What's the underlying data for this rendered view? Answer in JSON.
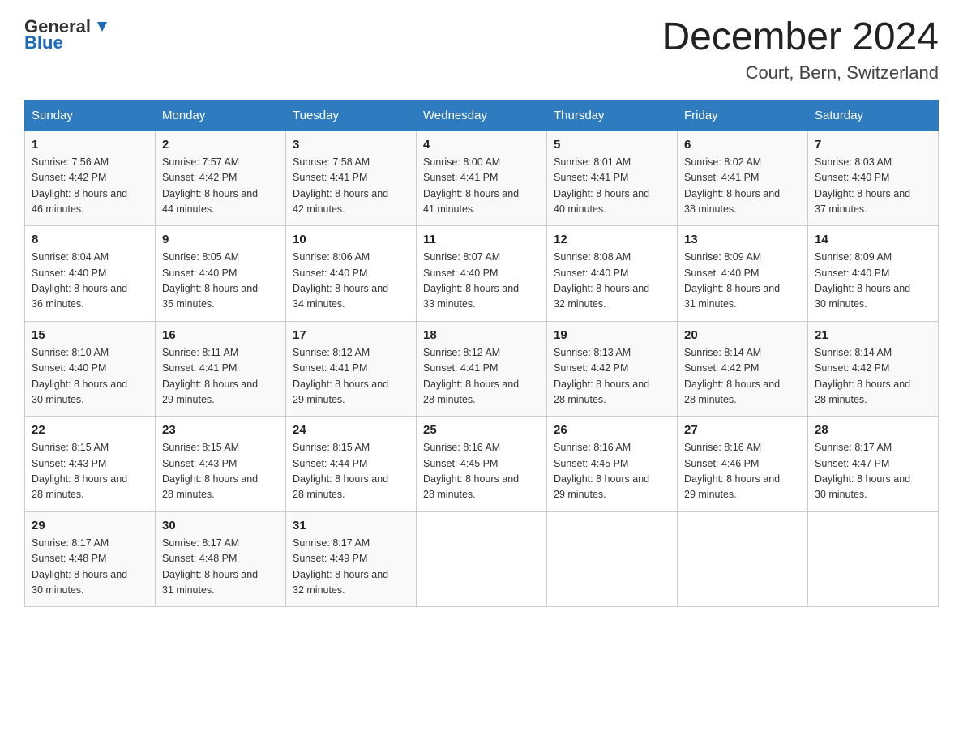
{
  "header": {
    "logo_general": "General",
    "logo_blue": "Blue",
    "month_title": "December 2024",
    "location": "Court, Bern, Switzerland"
  },
  "columns": [
    "Sunday",
    "Monday",
    "Tuesday",
    "Wednesday",
    "Thursday",
    "Friday",
    "Saturday"
  ],
  "weeks": [
    [
      {
        "day": "1",
        "sunrise": "7:56 AM",
        "sunset": "4:42 PM",
        "daylight": "8 hours and 46 minutes."
      },
      {
        "day": "2",
        "sunrise": "7:57 AM",
        "sunset": "4:42 PM",
        "daylight": "8 hours and 44 minutes."
      },
      {
        "day": "3",
        "sunrise": "7:58 AM",
        "sunset": "4:41 PM",
        "daylight": "8 hours and 42 minutes."
      },
      {
        "day": "4",
        "sunrise": "8:00 AM",
        "sunset": "4:41 PM",
        "daylight": "8 hours and 41 minutes."
      },
      {
        "day": "5",
        "sunrise": "8:01 AM",
        "sunset": "4:41 PM",
        "daylight": "8 hours and 40 minutes."
      },
      {
        "day": "6",
        "sunrise": "8:02 AM",
        "sunset": "4:41 PM",
        "daylight": "8 hours and 38 minutes."
      },
      {
        "day": "7",
        "sunrise": "8:03 AM",
        "sunset": "4:40 PM",
        "daylight": "8 hours and 37 minutes."
      }
    ],
    [
      {
        "day": "8",
        "sunrise": "8:04 AM",
        "sunset": "4:40 PM",
        "daylight": "8 hours and 36 minutes."
      },
      {
        "day": "9",
        "sunrise": "8:05 AM",
        "sunset": "4:40 PM",
        "daylight": "8 hours and 35 minutes."
      },
      {
        "day": "10",
        "sunrise": "8:06 AM",
        "sunset": "4:40 PM",
        "daylight": "8 hours and 34 minutes."
      },
      {
        "day": "11",
        "sunrise": "8:07 AM",
        "sunset": "4:40 PM",
        "daylight": "8 hours and 33 minutes."
      },
      {
        "day": "12",
        "sunrise": "8:08 AM",
        "sunset": "4:40 PM",
        "daylight": "8 hours and 32 minutes."
      },
      {
        "day": "13",
        "sunrise": "8:09 AM",
        "sunset": "4:40 PM",
        "daylight": "8 hours and 31 minutes."
      },
      {
        "day": "14",
        "sunrise": "8:09 AM",
        "sunset": "4:40 PM",
        "daylight": "8 hours and 30 minutes."
      }
    ],
    [
      {
        "day": "15",
        "sunrise": "8:10 AM",
        "sunset": "4:40 PM",
        "daylight": "8 hours and 30 minutes."
      },
      {
        "day": "16",
        "sunrise": "8:11 AM",
        "sunset": "4:41 PM",
        "daylight": "8 hours and 29 minutes."
      },
      {
        "day": "17",
        "sunrise": "8:12 AM",
        "sunset": "4:41 PM",
        "daylight": "8 hours and 29 minutes."
      },
      {
        "day": "18",
        "sunrise": "8:12 AM",
        "sunset": "4:41 PM",
        "daylight": "8 hours and 28 minutes."
      },
      {
        "day": "19",
        "sunrise": "8:13 AM",
        "sunset": "4:42 PM",
        "daylight": "8 hours and 28 minutes."
      },
      {
        "day": "20",
        "sunrise": "8:14 AM",
        "sunset": "4:42 PM",
        "daylight": "8 hours and 28 minutes."
      },
      {
        "day": "21",
        "sunrise": "8:14 AM",
        "sunset": "4:42 PM",
        "daylight": "8 hours and 28 minutes."
      }
    ],
    [
      {
        "day": "22",
        "sunrise": "8:15 AM",
        "sunset": "4:43 PM",
        "daylight": "8 hours and 28 minutes."
      },
      {
        "day": "23",
        "sunrise": "8:15 AM",
        "sunset": "4:43 PM",
        "daylight": "8 hours and 28 minutes."
      },
      {
        "day": "24",
        "sunrise": "8:15 AM",
        "sunset": "4:44 PM",
        "daylight": "8 hours and 28 minutes."
      },
      {
        "day": "25",
        "sunrise": "8:16 AM",
        "sunset": "4:45 PM",
        "daylight": "8 hours and 28 minutes."
      },
      {
        "day": "26",
        "sunrise": "8:16 AM",
        "sunset": "4:45 PM",
        "daylight": "8 hours and 29 minutes."
      },
      {
        "day": "27",
        "sunrise": "8:16 AM",
        "sunset": "4:46 PM",
        "daylight": "8 hours and 29 minutes."
      },
      {
        "day": "28",
        "sunrise": "8:17 AM",
        "sunset": "4:47 PM",
        "daylight": "8 hours and 30 minutes."
      }
    ],
    [
      {
        "day": "29",
        "sunrise": "8:17 AM",
        "sunset": "4:48 PM",
        "daylight": "8 hours and 30 minutes."
      },
      {
        "day": "30",
        "sunrise": "8:17 AM",
        "sunset": "4:48 PM",
        "daylight": "8 hours and 31 minutes."
      },
      {
        "day": "31",
        "sunrise": "8:17 AM",
        "sunset": "4:49 PM",
        "daylight": "8 hours and 32 minutes."
      },
      null,
      null,
      null,
      null
    ]
  ]
}
